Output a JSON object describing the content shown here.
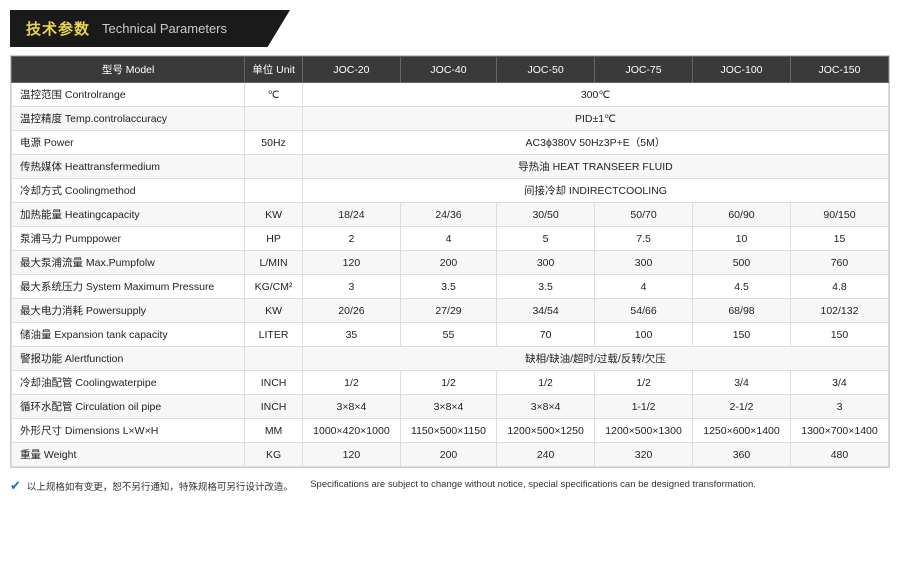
{
  "header": {
    "zh": "技术参数",
    "en": "Technical Parameters"
  },
  "table": {
    "columns": [
      "型号 Model",
      "单位 Unit",
      "JOC-20",
      "JOC-40",
      "JOC-50",
      "JOC-75",
      "JOC-100",
      "JOC-150"
    ],
    "rows": [
      {
        "label": "温控范围 Controlrange",
        "unit": "℃",
        "merged": true,
        "mergedValue": "300℃"
      },
      {
        "label": "温控精度 Temp.controlaccuracy",
        "unit": "",
        "merged": true,
        "mergedValue": "PID±1℃"
      },
      {
        "label": "电源 Power",
        "unit": "50Hz",
        "merged": true,
        "mergedValue": "AC3ϕ380V 50Hz3P+E（5M）"
      },
      {
        "label": "传热媒体 Heattransfermedium",
        "unit": "",
        "merged": true,
        "mergedValue": "导热油 HEAT TRANSEER FLUID"
      },
      {
        "label": "冷却方式 Coolingmethod",
        "unit": "",
        "merged": true,
        "mergedValue": "间接冷却 INDIRECTCOOLING"
      },
      {
        "label": "加热能量 Heatingcapacity",
        "unit": "KW",
        "merged": false,
        "values": [
          "18/24",
          "24/36",
          "30/50",
          "50/70",
          "60/90",
          "90/150"
        ]
      },
      {
        "label": "泵浦马力 Pumppower",
        "unit": "HP",
        "merged": false,
        "values": [
          "2",
          "4",
          "5",
          "7.5",
          "10",
          "15"
        ]
      },
      {
        "label": "最大泵浦流量 Max.Pumpfolw",
        "unit": "L/MIN",
        "merged": false,
        "values": [
          "120",
          "200",
          "300",
          "300",
          "500",
          "760"
        ]
      },
      {
        "label": "最大系统压力 System Maximum Pressure",
        "unit": "KG/CM²",
        "merged": false,
        "values": [
          "3",
          "3.5",
          "3.5",
          "4",
          "4.5",
          "4.8"
        ]
      },
      {
        "label": "最大电力消耗 Powersupply",
        "unit": "KW",
        "merged": false,
        "values": [
          "20/26",
          "27/29",
          "34/54",
          "54/66",
          "68/98",
          "102/132"
        ]
      },
      {
        "label": "储油量 Expansion tank capacity",
        "unit": "LITER",
        "merged": false,
        "values": [
          "35",
          "55",
          "70",
          "100",
          "150",
          "150"
        ]
      },
      {
        "label": "警报功能 Alertfunction",
        "unit": "",
        "merged": true,
        "mergedValue": "缺相/缺油/超时/过载/反转/欠压"
      },
      {
        "label": "冷却油配管 Coolingwaterpipe",
        "unit": "INCH",
        "merged": false,
        "values": [
          "1/2",
          "1/2",
          "1/2",
          "1/2",
          "3/4",
          "3/4"
        ]
      },
      {
        "label": "循环水配管 Circulation oil pipe",
        "unit": "INCH",
        "merged": false,
        "values": [
          "3×8×4",
          "3×8×4",
          "3×8×4",
          "1-1/2",
          "2-1/2",
          "3"
        ]
      },
      {
        "label": "外形尺寸 Dimensions L×W×H",
        "unit": "MM",
        "merged": false,
        "values": [
          "1000×420×1000",
          "1150×500×1150",
          "1200×500×1250",
          "1200×500×1300",
          "1250×600×1400",
          "1300×700×1400"
        ]
      },
      {
        "label": "重量 Weight",
        "unit": "KG",
        "merged": false,
        "values": [
          "120",
          "200",
          "240",
          "320",
          "360",
          "480"
        ]
      }
    ]
  },
  "footer": {
    "icon": "✔",
    "text_zh": "以上规格如有变更，恕不另行通知，特殊规格可另行设计改造。",
    "text_en": "Specifications are subject to change without notice, special specifications can be designed transformation."
  }
}
